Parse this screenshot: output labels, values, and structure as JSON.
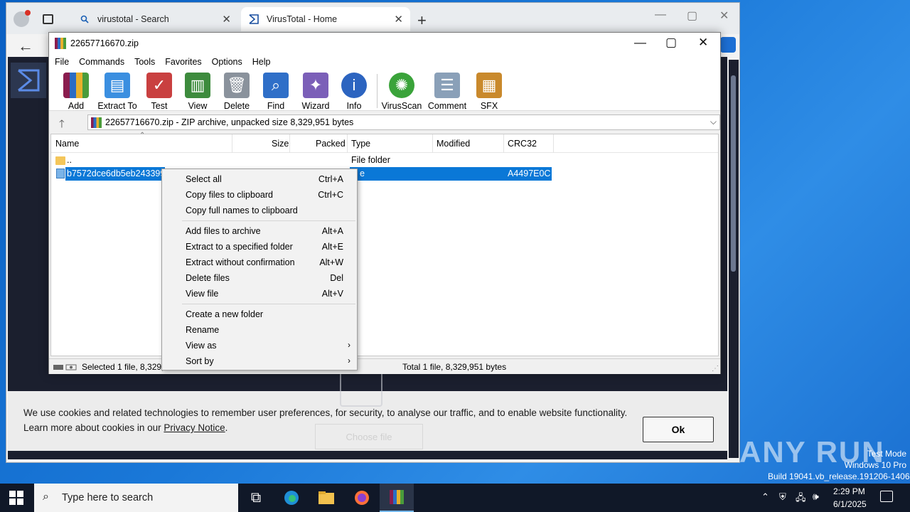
{
  "browser": {
    "tabs": [
      {
        "label": "virustotal - Search"
      },
      {
        "label": "VirusTotal - Home"
      }
    ],
    "new_tab": "+",
    "min": "—",
    "max": "▢",
    "close": "✕",
    "back": "←"
  },
  "cookie": {
    "line1": "We use cookies and related technologies to remember user preferences, for security, to analyse our traffic, and to enable website functionality.",
    "line2_prefix": "Learn more about cookies in our ",
    "link": "Privacy Notice",
    "line2_suffix": ".",
    "ok": "Ok",
    "choose_file": "Choose file"
  },
  "rar": {
    "title": "22657716670.zip",
    "menu": [
      "File",
      "Commands",
      "Tools",
      "Favorites",
      "Options",
      "Help"
    ],
    "toolbar": [
      {
        "label": "Add",
        "icon": "add-icon",
        "color": "#b23a2a"
      },
      {
        "label": "Extract To",
        "icon": "extract-icon",
        "color": "#3b8fe0"
      },
      {
        "label": "Test",
        "icon": "test-icon",
        "color": "#c94040"
      },
      {
        "label": "View",
        "icon": "view-icon",
        "color": "#3d8b3d"
      },
      {
        "label": "Delete",
        "icon": "delete-icon",
        "color": "#8a929c"
      },
      {
        "label": "Find",
        "icon": "find-icon",
        "color": "#2f6fc8"
      },
      {
        "label": "Wizard",
        "icon": "wizard-icon",
        "color": "#7b5fb8"
      },
      {
        "label": "Info",
        "icon": "info-icon",
        "color": "#2c64c0"
      },
      {
        "label": "VirusScan",
        "icon": "virusscan-icon",
        "color": "#3aa33a"
      },
      {
        "label": "Comment",
        "icon": "comment-icon",
        "color": "#8aa0b8"
      },
      {
        "label": "SFX",
        "icon": "sfx-icon",
        "color": "#c9892c"
      }
    ],
    "address": "22657716670.zip - ZIP archive, unpacked size 8,329,951 bytes",
    "columns": [
      "Name",
      "Size",
      "Packed",
      "Type",
      "Modified",
      "CRC32"
    ],
    "rows": [
      {
        "name": "..",
        "size": "",
        "packed": "",
        "type": "File folder",
        "modified": "",
        "crc": ""
      },
      {
        "name": "b7572dce6db5eb2433998",
        "size": "",
        "packed": "",
        "type": "e",
        "modified": "",
        "crc": "A4497E0C"
      }
    ],
    "status_left": "Selected 1 file, 8,329,9",
    "status_right": "Total 1 file, 8,329,951 bytes"
  },
  "context_menu": {
    "groups": [
      [
        {
          "label": "Select all",
          "key": "Ctrl+A"
        },
        {
          "label": "Copy files to clipboard",
          "key": "Ctrl+C"
        },
        {
          "label": "Copy full names to clipboard",
          "key": ""
        }
      ],
      [
        {
          "label": "Add files to archive",
          "key": "Alt+A"
        },
        {
          "label": "Extract to a specified folder",
          "key": "Alt+E"
        },
        {
          "label": "Extract without confirmation",
          "key": "Alt+W"
        },
        {
          "label": "Delete files",
          "key": "Del"
        },
        {
          "label": "View file",
          "key": "Alt+V"
        }
      ],
      [
        {
          "label": "Create a new folder",
          "key": ""
        },
        {
          "label": "Rename",
          "key": ""
        },
        {
          "label": "View as",
          "key": "",
          "submenu": true
        },
        {
          "label": "Sort by",
          "key": "",
          "submenu": true
        }
      ]
    ]
  },
  "taskbar": {
    "search_placeholder": "Type here to search",
    "time": "2:29 PM",
    "date": "6/1/2025"
  },
  "watermark": {
    "brand": "ANY RUN",
    "line1": "Test Mode",
    "line2": "Windows 10 Pro",
    "line3": "Build 19041.vb_release.191206-1406"
  }
}
